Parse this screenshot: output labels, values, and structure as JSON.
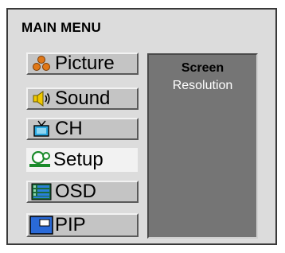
{
  "menu": {
    "title": "MAIN MENU",
    "items": [
      {
        "label": "Picture",
        "icon": "people-icon"
      },
      {
        "label": "Sound",
        "icon": "speaker-icon"
      },
      {
        "label": "CH",
        "icon": "tv-icon"
      },
      {
        "label": "Setup",
        "icon": "setup-person-icon",
        "selected": true
      },
      {
        "label": "OSD",
        "icon": "osd-list-icon"
      },
      {
        "label": "PIP",
        "icon": "pip-screen-icon"
      }
    ]
  },
  "panel": {
    "heading": "Screen",
    "subtext": "Resolution"
  },
  "colors": {
    "frame_bg": "#dcdcdc",
    "panel_bg": "#757575",
    "item_bg": "#c4c4c4",
    "item_selected_bg": "#f2f2f2"
  }
}
